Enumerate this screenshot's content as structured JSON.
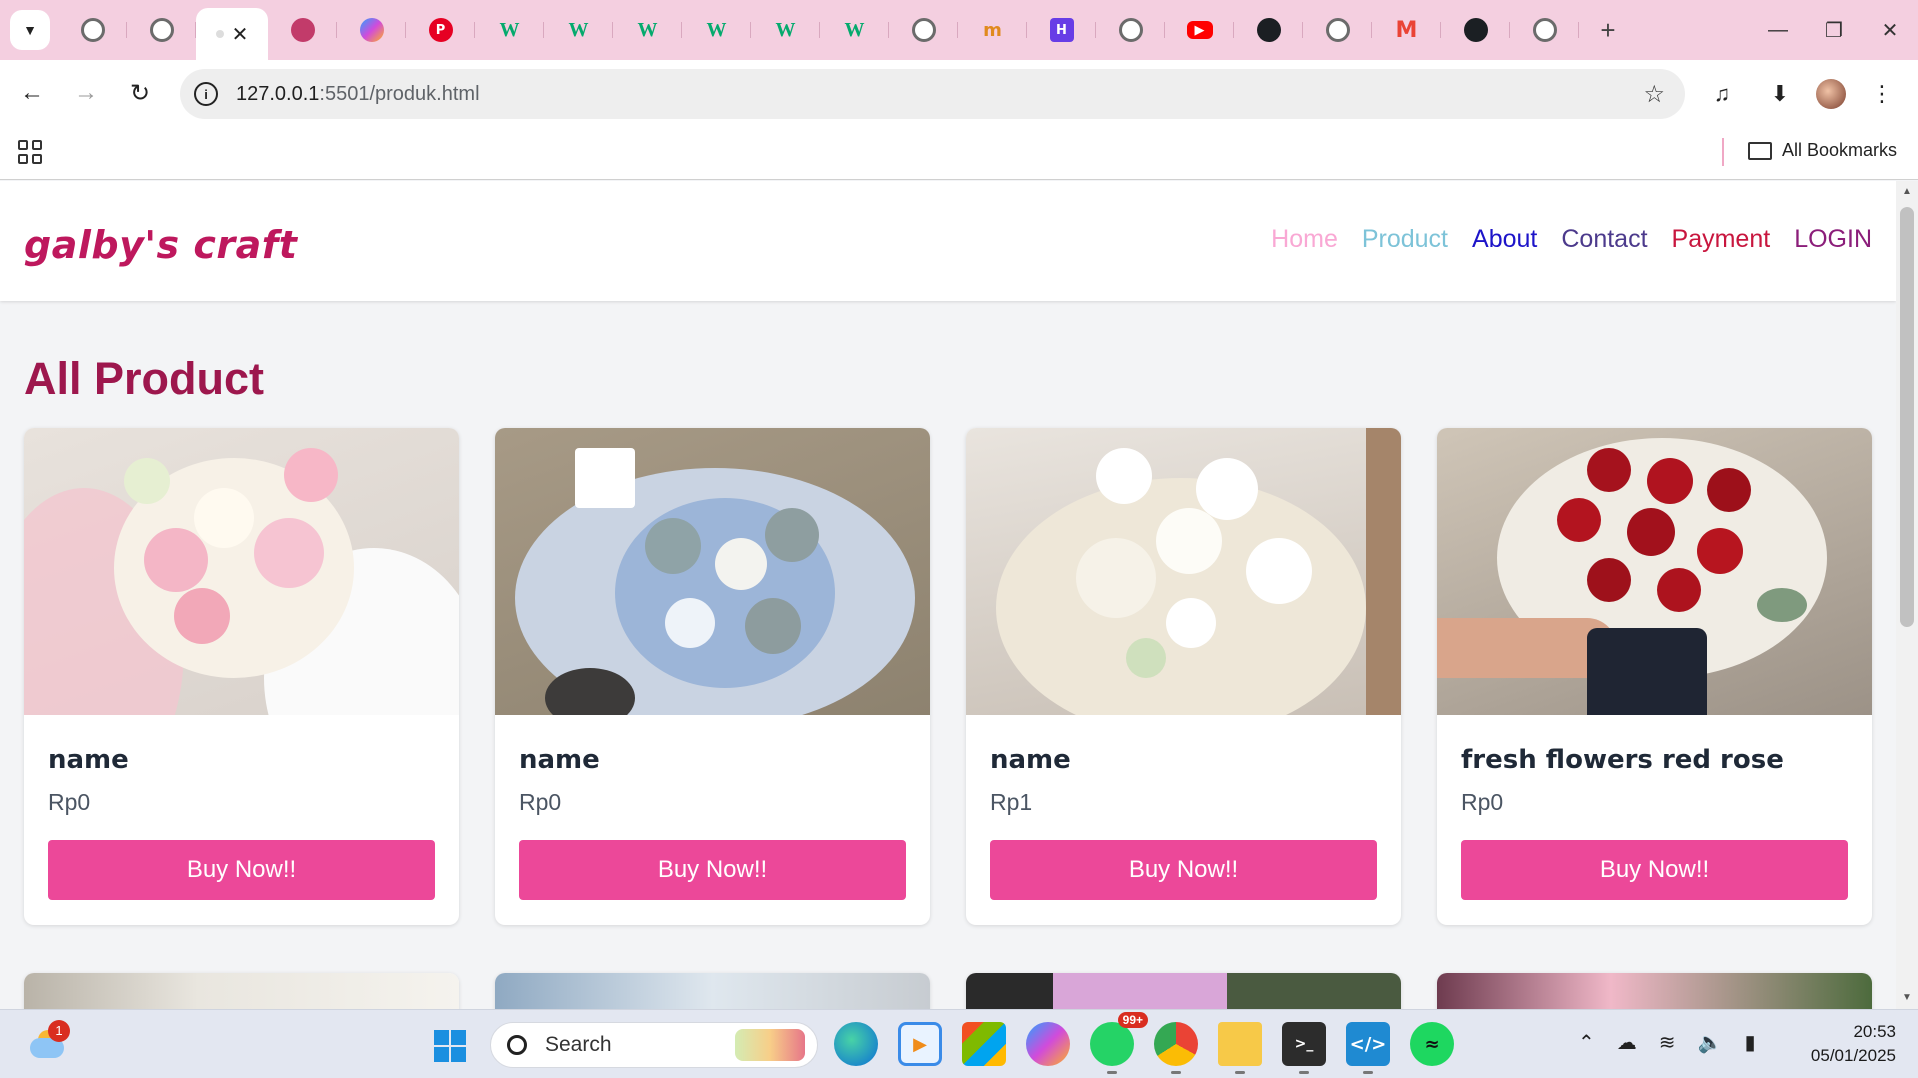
{
  "browser": {
    "tabs": [
      {
        "icon": "globe-icon",
        "active": false
      },
      {
        "icon": "globe-icon",
        "active": false
      },
      {
        "icon": "page-icon",
        "active": true
      },
      {
        "icon": "instagram-style-icon",
        "active": false
      },
      {
        "icon": "copilot-icon",
        "active": false
      },
      {
        "icon": "pinterest-icon",
        "active": false
      },
      {
        "icon": "w3schools-icon",
        "active": false
      },
      {
        "icon": "w3schools-icon",
        "active": false
      },
      {
        "icon": "w3schools-icon",
        "active": false
      },
      {
        "icon": "w3schools-icon",
        "active": false
      },
      {
        "icon": "w3schools-icon",
        "active": false
      },
      {
        "icon": "w3schools-icon",
        "active": false
      },
      {
        "icon": "globe-icon",
        "active": false
      },
      {
        "icon": "mn-icon",
        "active": false
      },
      {
        "icon": "hostinger-icon",
        "active": false
      },
      {
        "icon": "globe-icon",
        "active": false
      },
      {
        "icon": "youtube-icon",
        "active": false
      },
      {
        "icon": "github-icon",
        "active": false
      },
      {
        "icon": "globe-icon",
        "active": false
      },
      {
        "icon": "gmail-icon",
        "active": false
      },
      {
        "icon": "github-icon",
        "active": false
      },
      {
        "icon": "chrome-icon",
        "active": false
      }
    ],
    "url_host": "127.0.0.1",
    "url_rest": ":5501/produk.html",
    "bookmarks_label": "All Bookmarks",
    "colors": {
      "tab_strip": "#f4cfe0",
      "accent": "#ec4899"
    }
  },
  "site": {
    "logo": "galby's craft",
    "nav": {
      "home": "Home",
      "product": "Product",
      "about": "About",
      "contact": "Contact",
      "payment": "Payment",
      "login": "LOGIN"
    },
    "section_title": "All Product",
    "buy_label": "Buy Now!!",
    "products": [
      {
        "name": "name",
        "price": "Rp0"
      },
      {
        "name": "name",
        "price": "Rp0"
      },
      {
        "name": "name",
        "price": "Rp1"
      },
      {
        "name": "fresh flowers red rose",
        "price": "Rp0"
      }
    ]
  },
  "taskbar": {
    "weather_badge": "1",
    "search_placeholder": "Search",
    "whatsapp_badge": "99+",
    "time": "20:53",
    "date": "05/01/2025"
  }
}
